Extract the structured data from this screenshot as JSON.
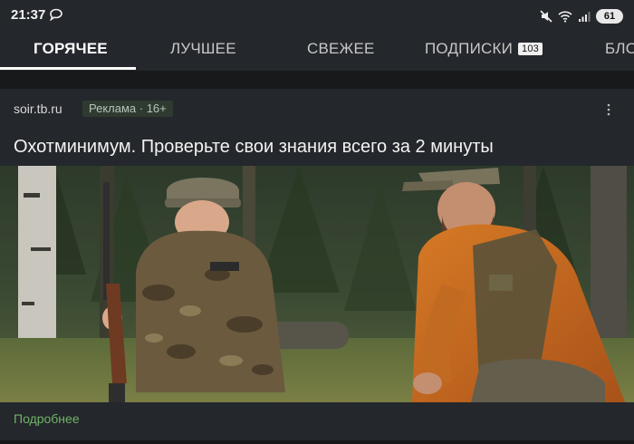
{
  "status_bar": {
    "time": "21:37",
    "left_icon": "chat-bubble-icon",
    "right_icons": [
      "mute-icon",
      "wifi-icon",
      "signal-icon"
    ],
    "battery": "61"
  },
  "tabs": [
    {
      "label": "ГОРЯЧЕЕ",
      "active": true
    },
    {
      "label": "ЛУЧШЕЕ"
    },
    {
      "label": "СВЕЖЕЕ"
    },
    {
      "label": "ПОДПИСКИ",
      "badge": "103"
    },
    {
      "label": "БЛОГИ"
    }
  ],
  "card": {
    "source": "soir.tb.ru",
    "badge": "Реклама · 16+",
    "title": "Охотминимум. Проверьте свои знания всего за 2 минуты",
    "more_link": "Подробнее",
    "colors": {
      "link": "#6fb36a",
      "badge_bg": "#2f3a31"
    }
  }
}
